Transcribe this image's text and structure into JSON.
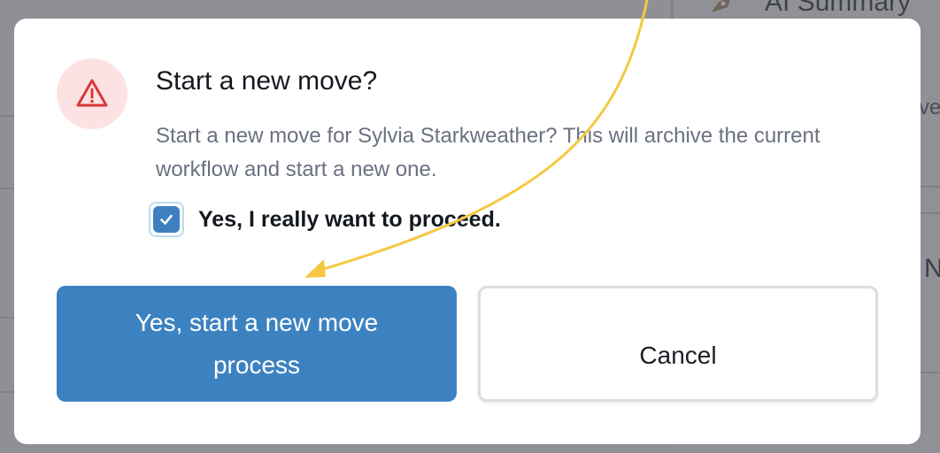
{
  "background": {
    "panel_title": "AI Summary",
    "snippet_a": "ve",
    "snippet_b": "N"
  },
  "dialog": {
    "title": "Start a new move?",
    "description": "Start a new move for Sylvia Starkweather? This will archive the current workflow and start a new one.",
    "confirm_checkbox": {
      "checked": true,
      "label": "Yes, I really want to proceed."
    },
    "primary_button": "Yes, start a new move process",
    "cancel_button": "Cancel",
    "icon": "warning-triangle-icon"
  },
  "colors": {
    "primary": "#3d82c0",
    "warning_icon": "#d9383a",
    "warning_bg": "#fce2e2",
    "annotation_arrow": "#f5c842"
  }
}
